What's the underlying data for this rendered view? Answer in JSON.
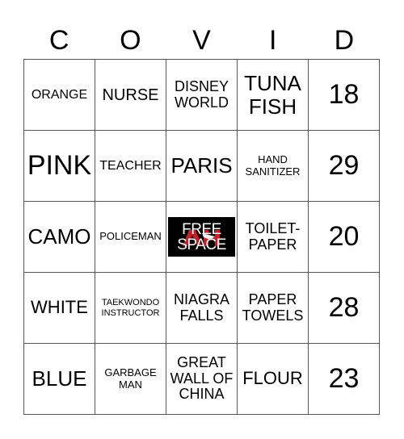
{
  "title_letters": [
    "C",
    "O",
    "V",
    "I",
    "D"
  ],
  "cells": [
    [
      {
        "text": "ORANGE",
        "size": "s-s"
      },
      {
        "text": "NURSE",
        "size": "s-ml"
      },
      {
        "text": "DISNEY WORLD",
        "size": "s-n"
      },
      {
        "text": "TUNA FISH",
        "size": "s-l"
      },
      {
        "text": "18",
        "size": "s-xl"
      }
    ],
    [
      {
        "text": "PINK",
        "size": "s-xl"
      },
      {
        "text": "TEACHER",
        "size": "s-s"
      },
      {
        "text": "PARIS",
        "size": "s-l"
      },
      {
        "text": "HAND SANITIZER",
        "size": "s-t"
      },
      {
        "text": "29",
        "size": "s-xl"
      }
    ],
    [
      {
        "text": "CAMO",
        "size": "s-l"
      },
      {
        "text": "POLICEMAN",
        "size": "s-xs"
      },
      {
        "text": "FREE SPACE",
        "size": "free"
      },
      {
        "text": "TOILET-PAPER",
        "size": "s-n"
      },
      {
        "text": "20",
        "size": "s-xl"
      }
    ],
    [
      {
        "text": "WHITE",
        "size": "s-m"
      },
      {
        "text": "TAEKWONDO INSTRUCTOR",
        "size": "s-xxs"
      },
      {
        "text": "NIAGRA FALLS",
        "size": "s-n"
      },
      {
        "text": "PAPER TOWELS",
        "size": "s-n"
      },
      {
        "text": "28",
        "size": "s-xl"
      }
    ],
    [
      {
        "text": "BLUE",
        "size": "s-l"
      },
      {
        "text": "GARBAGE MAN",
        "size": "s-xs"
      },
      {
        "text": "GREAT WALL OF CHINA",
        "size": "s-n"
      },
      {
        "text": "FLOUR",
        "size": "s-m"
      },
      {
        "text": "23",
        "size": "s-xl"
      }
    ]
  ],
  "free_space": {
    "line1": "FREE",
    "line2": "SPACE",
    "logo": "red-team-logo",
    "bg": "#000000",
    "accent": "#cc1f2a"
  }
}
